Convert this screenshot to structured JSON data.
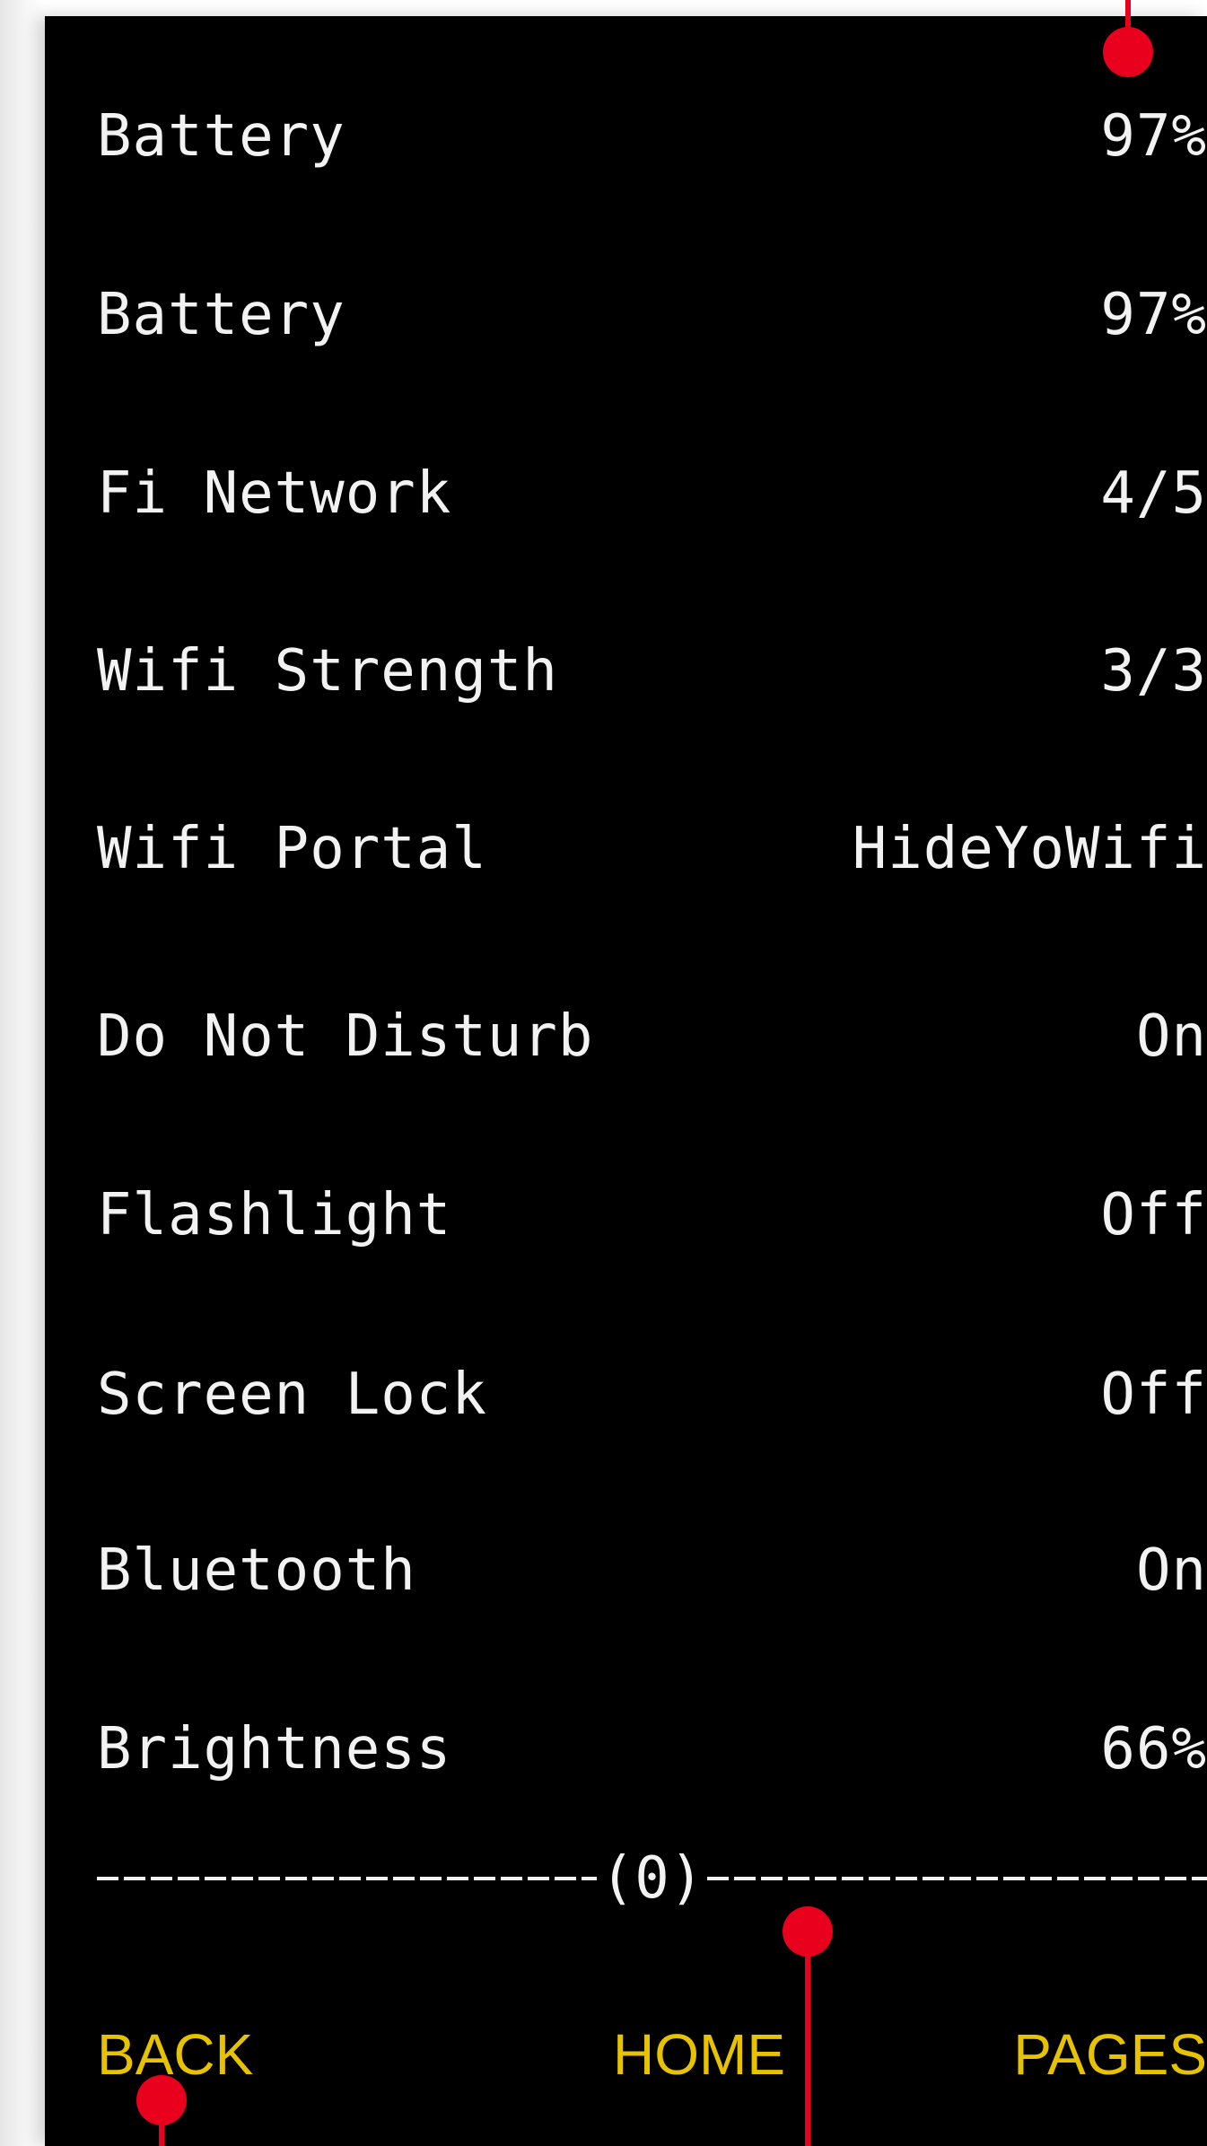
{
  "rows": [
    {
      "label": "Battery",
      "value": "97%"
    },
    {
      "label": "Battery",
      "value": "97%"
    },
    {
      "label": "Fi Network",
      "value": "4/5"
    },
    {
      "label": "Wifi Strength",
      "value": "3/3"
    },
    {
      "label": "Wifi Portal",
      "value": "HideYoWifi"
    },
    {
      "label": "Do Not Disturb",
      "value": "On"
    },
    {
      "label": "Flashlight",
      "value": "Off"
    },
    {
      "label": "Screen Lock",
      "value": "Off"
    },
    {
      "label": "Bluetooth",
      "value": "On"
    },
    {
      "label": "Brightness",
      "value": "66%"
    }
  ],
  "divider": {
    "counter": "(0)"
  },
  "nav": {
    "back": "BACK",
    "home": "HOME",
    "pages": "PAGES"
  },
  "colors": {
    "background": "#000000",
    "text": "#f2f2f2",
    "nav_text": "#e6c200",
    "marker": "#e8001c"
  }
}
